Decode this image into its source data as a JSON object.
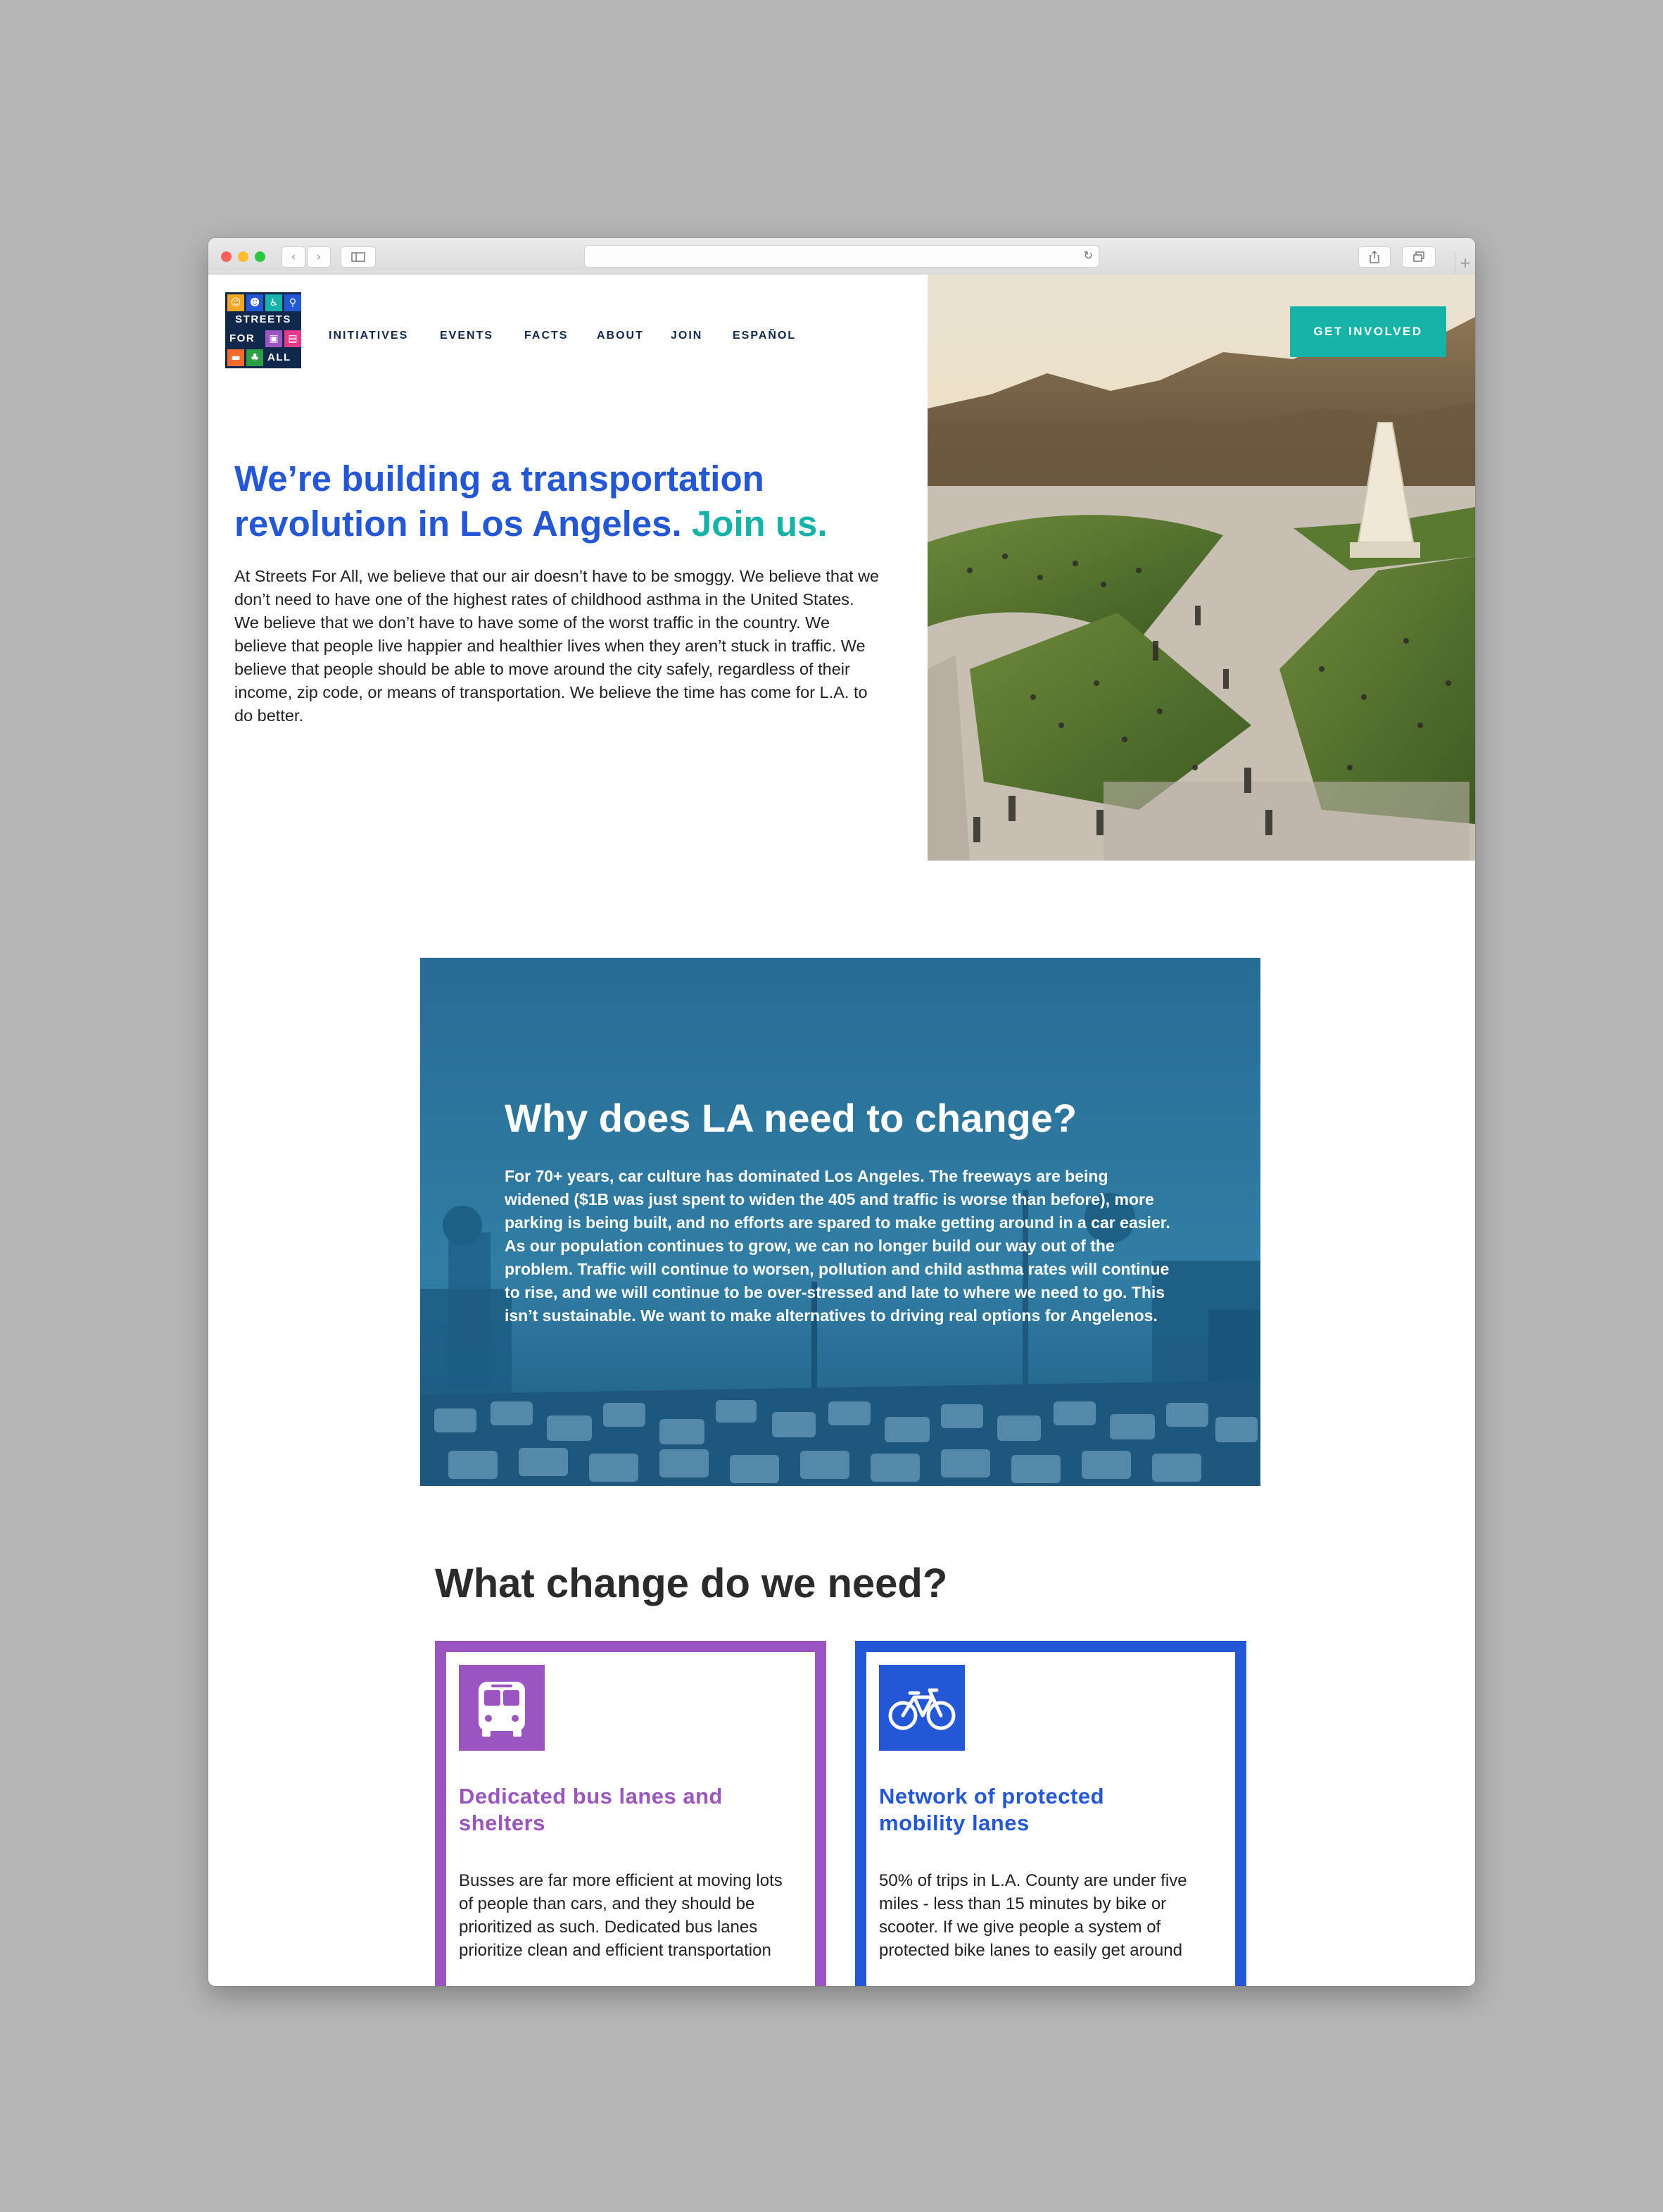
{
  "browser": {
    "back_icon": "chevron-left-icon",
    "forward_icon": "chevron-right-icon",
    "sidebar_icon": "sidebar-icon",
    "reload_icon": "reload-icon",
    "share_icon": "share-icon",
    "tabs_icon": "tabs-icon",
    "new_tab_label": "+"
  },
  "logo": {
    "line1": "STREETS",
    "line2": "FOR",
    "line3": "ALL",
    "tile_colors": [
      "#f5a623",
      "#2457d6",
      "#17b3a8",
      "#2457d6",
      "#9b55c0",
      "#e8388a",
      "#f26b2e",
      "#2e9e44"
    ]
  },
  "nav": {
    "items": [
      "INITIATIVES",
      "EVENTS",
      "FACTS",
      "ABOUT",
      "JOIN",
      "ESPAÑOL"
    ]
  },
  "cta": {
    "label": "GET INVOLVED"
  },
  "hero": {
    "headline": "We’re building a transportation revolution in Los Angeles.",
    "headline_accent": "Join us.",
    "intro": "At Streets For All, we believe that our air doesn’t have to be smoggy. We believe that we don’t need to have one of the highest rates of childhood asthma in the United States. We believe that we don’t have to have some of the worst traffic in the country. We believe that people live happier and healthier lives when they aren’t stuck in traffic. We believe that people should be able to move around the city safely, regardless of their income, zip code, or means of transportation. We believe the time has come for L.A. to do better."
  },
  "why": {
    "title": "Why does LA need to change?",
    "body": "For 70+ years, car culture has dominated Los Angeles. The freeways are being widened ($1B was just spent to widen the 405 and traffic is worse than before), more parking is being built, and no efforts are spared to make getting around in a car easier. As our population continues to grow, we can no longer build our way out of the problem. Traffic will continue to worsen, pollution and child asthma rates will continue to rise, and we will continue to be over-stressed and late to where we need to go. This isn’t sustainable. We want to make alternatives to driving real options for Angelenos."
  },
  "change": {
    "title": "What change do we need?",
    "cards": [
      {
        "icon": "bus-icon",
        "color": "#9b55c0",
        "title": "Dedicated bus lanes and shelters",
        "body": "Busses are far more efficient at moving lots of people than cars, and they should be prioritized as such. Dedicated bus lanes prioritize clean and efficient transportation"
      },
      {
        "icon": "bicycle-icon",
        "color": "#2457d6",
        "title": "Network of protected mobility lanes",
        "body": "50% of trips in L.A. County are under five miles - less than 15 minutes by bike or scooter. If we give people a system of protected bike lanes to easily get around"
      }
    ]
  }
}
